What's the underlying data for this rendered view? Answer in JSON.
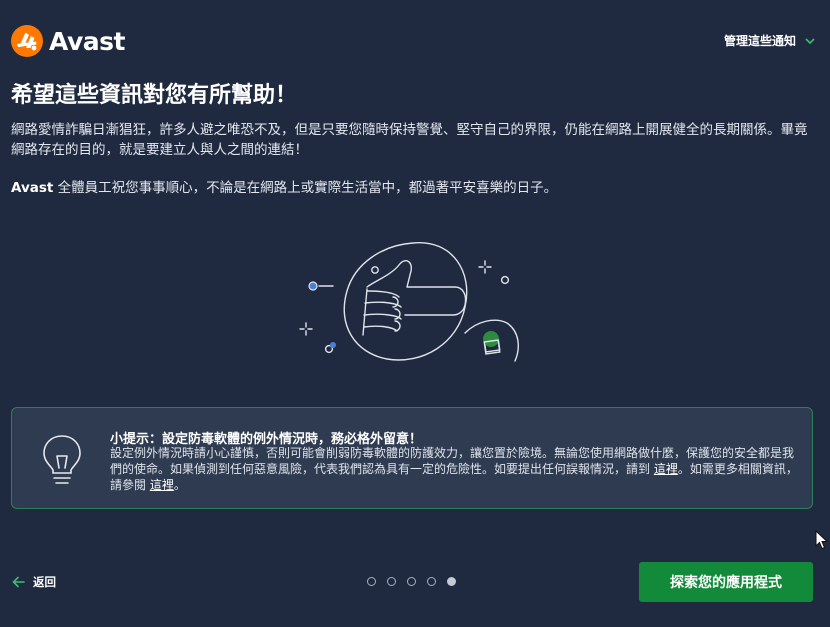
{
  "brand": {
    "name": "Avast",
    "color": "#ff7800"
  },
  "header": {
    "manage_label": "管理這些通知"
  },
  "title": "希望這些資訊對您有所幫助！",
  "paragraphs": {
    "p1": "網路愛情詐騙日漸猖狂，許多人避之唯恐不及，但是只要您隨時保持警覺、堅守自己的界限，仍能在網路上開展健全的長期關係。畢竟網路存在的目的，就是要建立人與人之間的連結！",
    "p2_brand": "Avast",
    "p2_rest": " 全體員工祝您事事順心，不論是在網路上或實際生活當中，都過著平安喜樂的日子。"
  },
  "tip": {
    "title": "小提示：設定防毒軟體的例外情況時，務必格外留意！",
    "body_part1": "設定例外情況時請小心謹慎，否則可能會削弱防毒軟體的防護效力，讓您置於險境。無論您使用網路做什麼，保護您的安全都是我們的使命。如果偵測到任何惡意風險，代表我們認為具有一定的危險性。如要提出任何誤報情況，請到 ",
    "link1": "這裡",
    "body_part2": "。如需更多相關資訊，請參閱 ",
    "link2": "這裡",
    "body_part3": "。",
    "border_color": "#2e7d5b"
  },
  "footer": {
    "back_label": "返回",
    "cta_label": "探索您的應用程式",
    "cta_color": "#138a3a",
    "pages": {
      "total": 5,
      "current": 5
    }
  },
  "icons": [
    "avast-logo-icon",
    "chevron-down-icon",
    "lightbulb-icon",
    "arrow-left-icon",
    "thumbs-up-illustration",
    "mouse-cursor-icon"
  ]
}
